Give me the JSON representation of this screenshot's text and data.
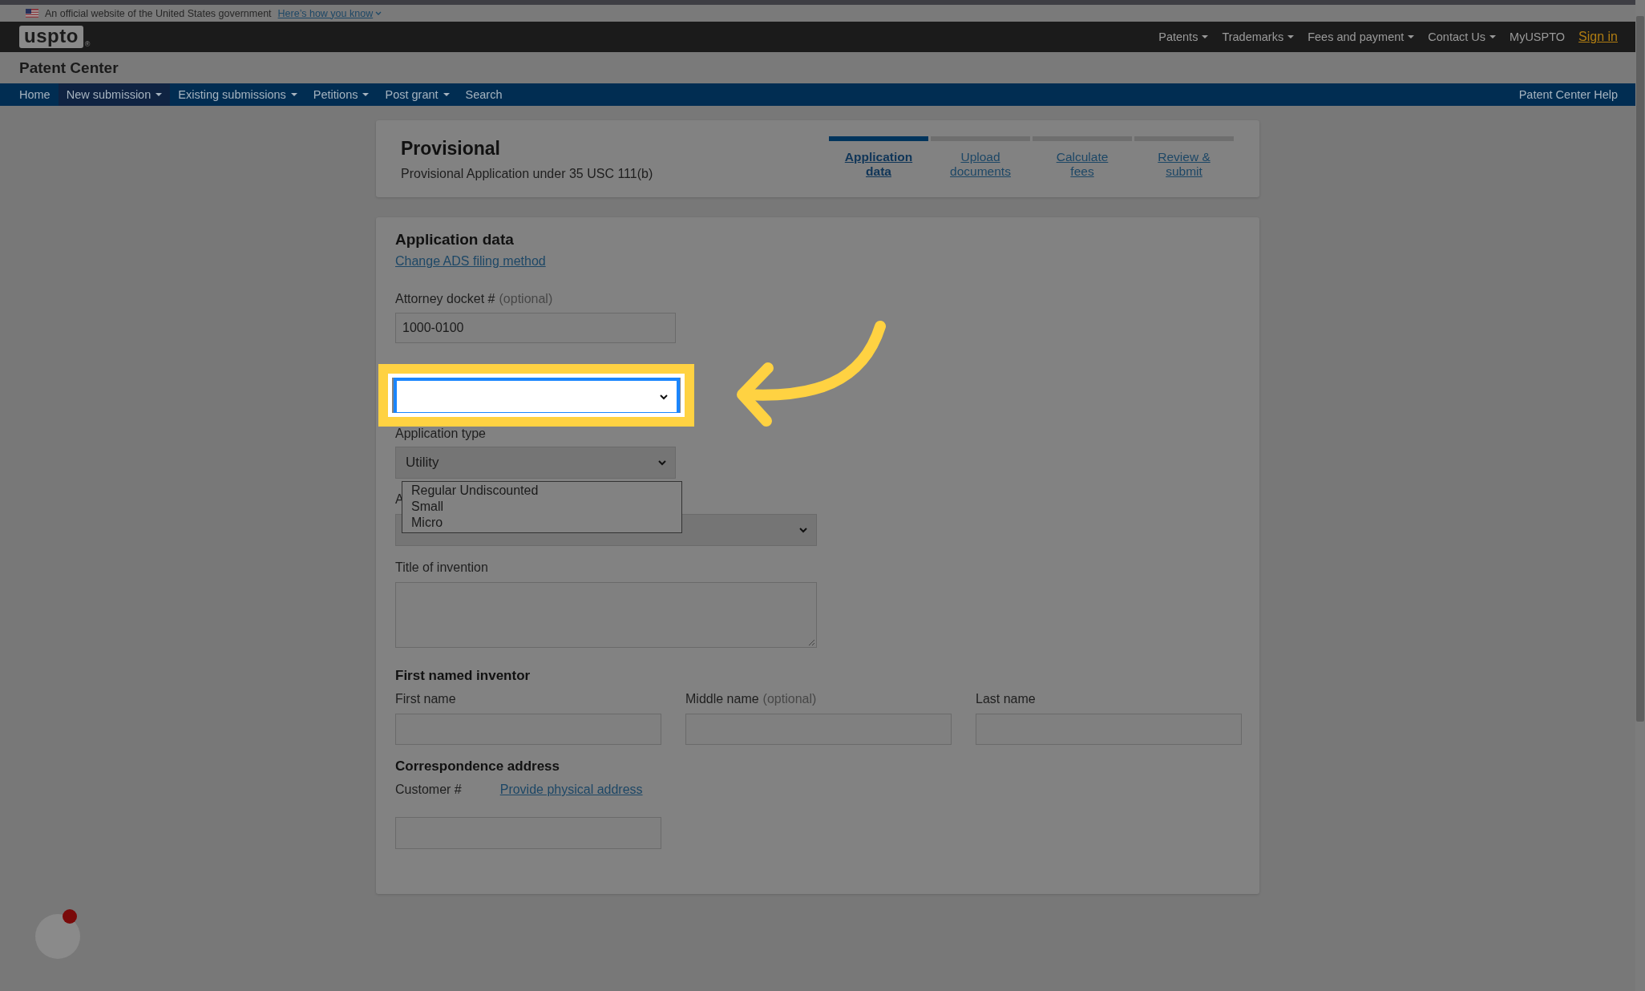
{
  "gov_banner": {
    "text": "An official website of the United States government",
    "link": "Here’s how you know"
  },
  "header": {
    "logo": "uspto",
    "logo_mark": "®",
    "menu": [
      {
        "label": "Patents",
        "dropdown": true
      },
      {
        "label": "Trademarks",
        "dropdown": true
      },
      {
        "label": "Fees and payment",
        "dropdown": true
      },
      {
        "label": "Contact Us",
        "dropdown": true
      },
      {
        "label": "MyUSPTO",
        "dropdown": false
      }
    ],
    "sign_in": "Sign in"
  },
  "app_title": "Patent Center",
  "nav": {
    "items": [
      {
        "label": "Home",
        "dropdown": false,
        "selected": false
      },
      {
        "label": "New submission",
        "dropdown": true,
        "selected": true
      },
      {
        "label": "Existing submissions",
        "dropdown": true,
        "selected": false
      },
      {
        "label": "Petitions",
        "dropdown": true,
        "selected": false
      },
      {
        "label": "Post grant",
        "dropdown": true,
        "selected": false
      },
      {
        "label": "Search",
        "dropdown": false,
        "selected": false
      }
    ],
    "help": "Patent Center Help"
  },
  "summary": {
    "title": "Provisional",
    "subtitle": "Provisional Application under 35 USC 111(b)",
    "steps": [
      {
        "label": "Application data",
        "selected": true
      },
      {
        "label": "Upload documents",
        "selected": false
      },
      {
        "label": "Calculate fees",
        "selected": false
      },
      {
        "label": "Review & submit",
        "selected": false
      }
    ]
  },
  "form": {
    "heading": "Application data",
    "change_link": "Change ADS filing method",
    "attorney_docket": {
      "label": "Attorney docket #",
      "hint": "(optional)",
      "value": "1000-0100"
    },
    "entity_status": {
      "focused": true,
      "options": [
        "Regular Undiscounted",
        "Small",
        "Micro"
      ]
    },
    "application_type": {
      "label": "Application type",
      "value": "Utility"
    },
    "field_4": {
      "label": "A"
    },
    "title_of_invention": {
      "label": "Title of invention"
    },
    "inventor": {
      "heading": "First named inventor",
      "fields": [
        {
          "label": "First name"
        },
        {
          "label": "Middle name",
          "hint": "(optional)"
        },
        {
          "label": "Last name"
        }
      ]
    },
    "correspondence": {
      "heading": "Correspondence address",
      "label": "Customer #",
      "link": "Provide physical address"
    }
  }
}
